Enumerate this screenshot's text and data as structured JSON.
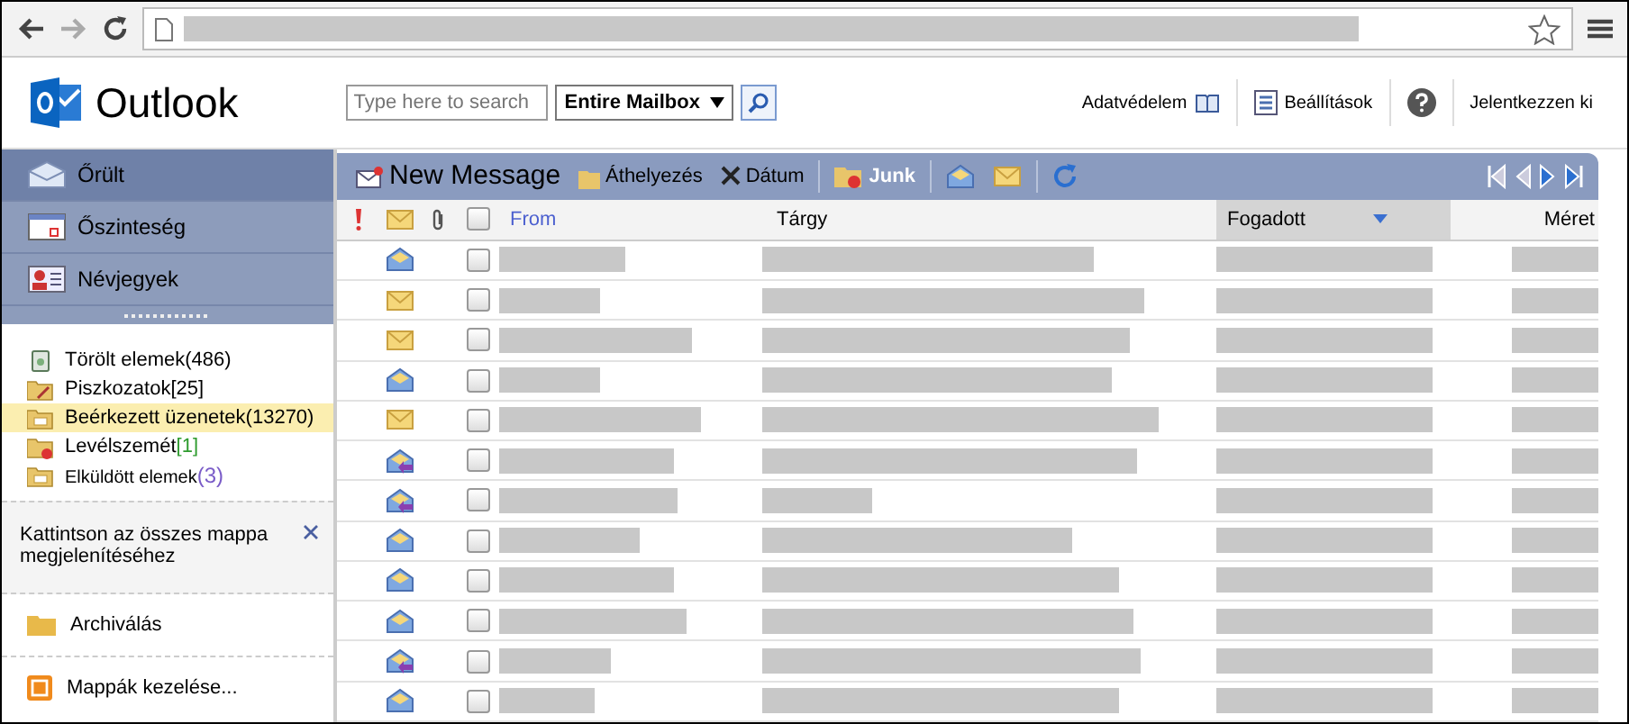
{
  "header": {
    "app_name": "Outlook",
    "search": {
      "placeholder": "Type here to search"
    },
    "scope": "Entire Mailbox",
    "links": [
      {
        "label": "Adatvédelem",
        "kind": "privacy"
      },
      {
        "label": "Beállítások",
        "kind": "settings"
      },
      {
        "kind": "help"
      },
      {
        "label": "Jelentkezzen ki",
        "kind": "plain"
      }
    ]
  },
  "nav": [
    {
      "label": "Őrült",
      "kind": "mail",
      "selected": true
    },
    {
      "label": "Őszinteség",
      "kind": "calendar",
      "selected": false
    },
    {
      "label": "Névjegyek",
      "kind": "contacts",
      "selected": false
    }
  ],
  "folders": [
    {
      "name": "Törölt elemek",
      "count": "(486)",
      "kind": "trash",
      "selected": false
    },
    {
      "name": "Piszkozatok",
      "count": "[25]",
      "kind": "drafts",
      "selected": false
    },
    {
      "name": "Beérkezett üzenetek",
      "count": "(13270)",
      "kind": "inbox",
      "selected": true
    },
    {
      "name": "Levélszemét",
      "count": "[1]",
      "kind": "junk",
      "selected": false,
      "color": "#2e9b2e"
    },
    {
      "name": "Elküldött elemek",
      "count": "(3)",
      "kind": "sent",
      "selected": false,
      "color": "#7a5cc8"
    }
  ],
  "show_all_folders": "Kattintson az összes mappa megjelenítéséhez",
  "archive": "Archiválás",
  "manage_folders": "Mappák kezelése...",
  "toolbar": {
    "new_message": "New Message",
    "move": "Áthelyezés",
    "date": "Dátum",
    "junk": "Junk"
  },
  "select_all": {
    "checked": false
  },
  "columns": [
    {
      "label": "From",
      "sorted": false
    },
    {
      "label": "Tárgy",
      "sorted": false
    },
    {
      "label": "Fogadott",
      "sorted": true
    },
    {
      "label": "Méret",
      "sorted": false
    }
  ],
  "rows": [
    {
      "kind": "read",
      "checked": false
    },
    {
      "kind": "unread",
      "checked": false
    },
    {
      "kind": "unread",
      "checked": false
    },
    {
      "kind": "read",
      "checked": false
    },
    {
      "kind": "unread",
      "checked": false
    },
    {
      "kind": "replied",
      "checked": false
    },
    {
      "kind": "replied",
      "checked": false
    },
    {
      "kind": "read",
      "checked": false
    },
    {
      "kind": "read",
      "checked": false
    },
    {
      "kind": "read",
      "checked": false
    },
    {
      "kind": "replied",
      "checked": false
    },
    {
      "kind": "read",
      "checked": false
    }
  ]
}
